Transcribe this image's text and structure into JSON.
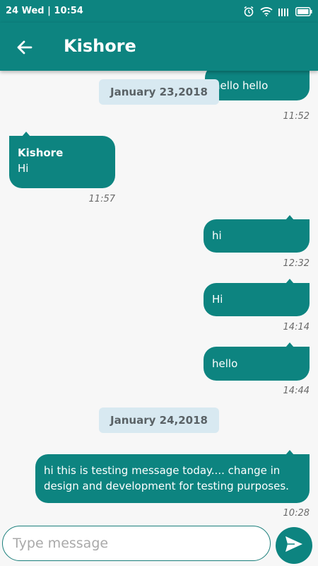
{
  "status_bar": {
    "text": "24 Wed  |  10:54"
  },
  "header": {
    "title": "Kishore"
  },
  "colors": {
    "primary": "#0d8480",
    "date_chip_bg": "#d8e9f1",
    "background": "#f7f7f7"
  },
  "messages": [
    {
      "text": "hello hello",
      "time": "11:52",
      "direction": "outgoing"
    },
    {
      "sender": "Kishore",
      "text": "Hi",
      "time": "11:57",
      "direction": "incoming"
    },
    {
      "text": "hi",
      "time": "12:32",
      "direction": "outgoing"
    },
    {
      "text": "Hi",
      "time": "14:14",
      "direction": "outgoing"
    },
    {
      "text": "hello",
      "time": "14:44",
      "direction": "outgoing"
    },
    {
      "text": "hi this is testing message today.... change in design and development for testing purposes.",
      "time": "10:28",
      "direction": "outgoing"
    }
  ],
  "date_separators": [
    "January 23,2018",
    "January 24,2018"
  ],
  "composer": {
    "placeholder": "Type message",
    "value": ""
  },
  "icons": {
    "back": "arrow-left-icon",
    "send": "send-icon",
    "alarm": "alarm-icon",
    "wifi": "wifi-icon",
    "signal": "signal-icon",
    "battery": "battery-icon"
  }
}
